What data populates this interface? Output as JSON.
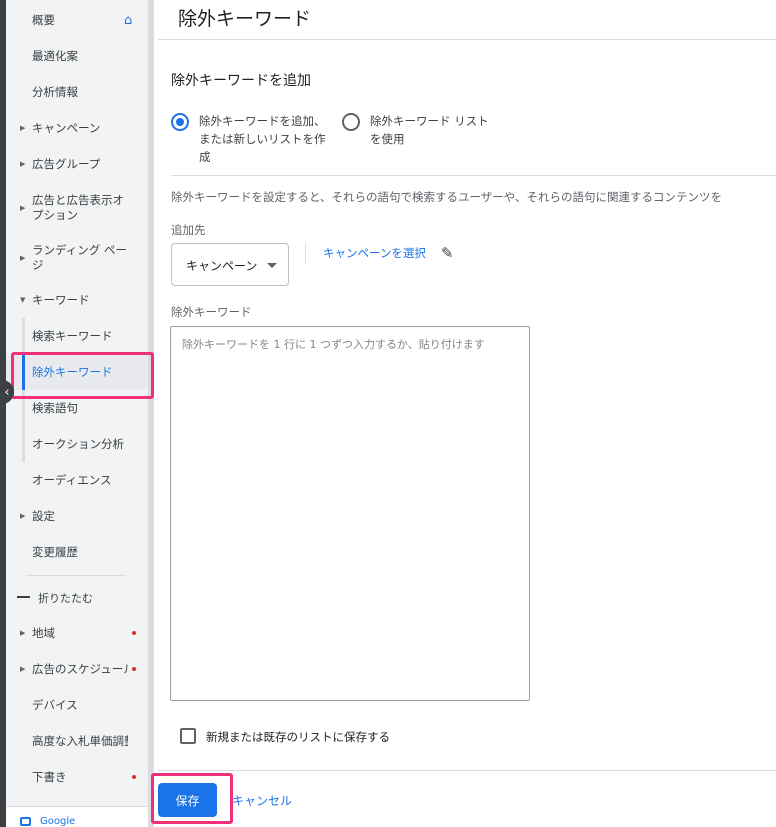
{
  "sidebar": {
    "items": [
      {
        "label": "概要"
      },
      {
        "label": "最適化案"
      },
      {
        "label": "分析情報"
      },
      {
        "label": "キャンペーン"
      },
      {
        "label": "広告グループ"
      },
      {
        "label": "広告と広告表示オプション"
      },
      {
        "label": "ランディング ページ"
      },
      {
        "label": "キーワード"
      },
      {
        "label": "検索キーワード"
      },
      {
        "label": "除外キーワード",
        "active": true
      },
      {
        "label": "検索語句"
      },
      {
        "label": "オークション分析"
      },
      {
        "label": "オーディエンス"
      },
      {
        "label": "設定"
      },
      {
        "label": "変更履歴"
      }
    ],
    "collapse_label": "折りたたむ",
    "more_items": [
      {
        "label": "地域"
      },
      {
        "label": "広告のスケジュール"
      },
      {
        "label": "デバイス"
      },
      {
        "label": "高度な入札単価調整"
      },
      {
        "label": "下書き"
      }
    ],
    "footer_label": "Google"
  },
  "header": {
    "title": "除外キーワード"
  },
  "form": {
    "section_title": "除外キーワードを追加",
    "radio_new_label_1": "除外キーワードを追加、",
    "radio_new_label_2": "または新しいリストを作",
    "radio_new_label_3": "成",
    "radio_list_label_1": "除外キーワード リスト",
    "radio_list_label_2": "を使用",
    "description": "除外キーワードを設定すると、それらの語句で検索するユーザーや、それらの語句に関連するコンテンツを",
    "add_to_label": "追加先",
    "add_to_value": "キャンペーン",
    "select_campaign_link": "キャンペーンを選択",
    "keywords_label": "除外キーワード",
    "keywords_placeholder": "除外キーワードを 1 行に 1 つずつ入力するか、貼り付けます",
    "save_to_list_label": "新規または既存のリストに保存する",
    "save_button": "保存",
    "cancel_button": "キャンセル"
  },
  "colors": {
    "accent": "#1a73e8",
    "highlight": "#f0307a",
    "status_dot": "#d93025"
  }
}
